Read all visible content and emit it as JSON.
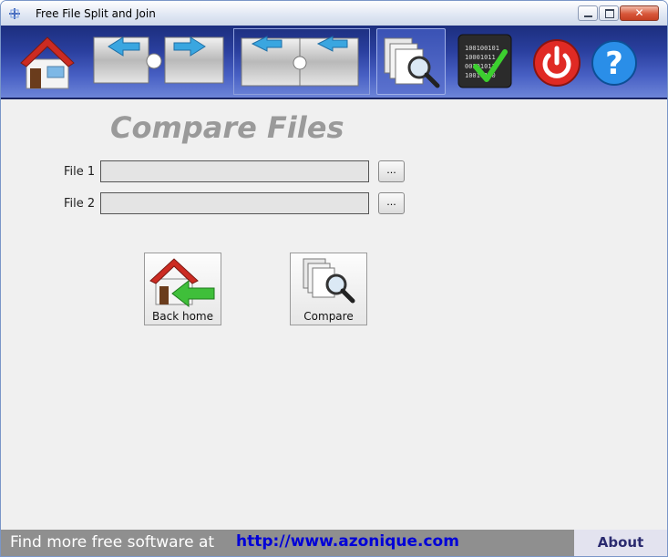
{
  "window": {
    "title": "Free File Split and Join",
    "close_glyph": "✕"
  },
  "toolbar": {
    "items": [
      {
        "name": "home",
        "icon": "home-icon"
      },
      {
        "name": "split",
        "icon": "split-puzzle-icon"
      },
      {
        "name": "join",
        "icon": "join-puzzle-icon"
      },
      {
        "name": "compare",
        "icon": "compare-files-icon",
        "active": true
      },
      {
        "name": "checksum",
        "icon": "binary-check-icon"
      },
      {
        "name": "exit",
        "icon": "power-icon"
      },
      {
        "name": "help",
        "icon": "help-icon"
      }
    ]
  },
  "main": {
    "title": "Compare Files",
    "file1_label": "File 1",
    "file1_value": "",
    "file2_label": "File 2",
    "file2_value": "",
    "browse_label": "...",
    "back_home_label": "Back home",
    "compare_label": "Compare"
  },
  "footer": {
    "text": "Find more free software at",
    "link": "http://www.azonique.com",
    "about": "About"
  },
  "colors": {
    "toolbar_top": "#1c2e7e",
    "toolbar_bottom": "#6d85d8",
    "title_gray": "#9a9a9a",
    "link_blue": "#0000d8",
    "footer_gray": "#8f8f8f"
  }
}
